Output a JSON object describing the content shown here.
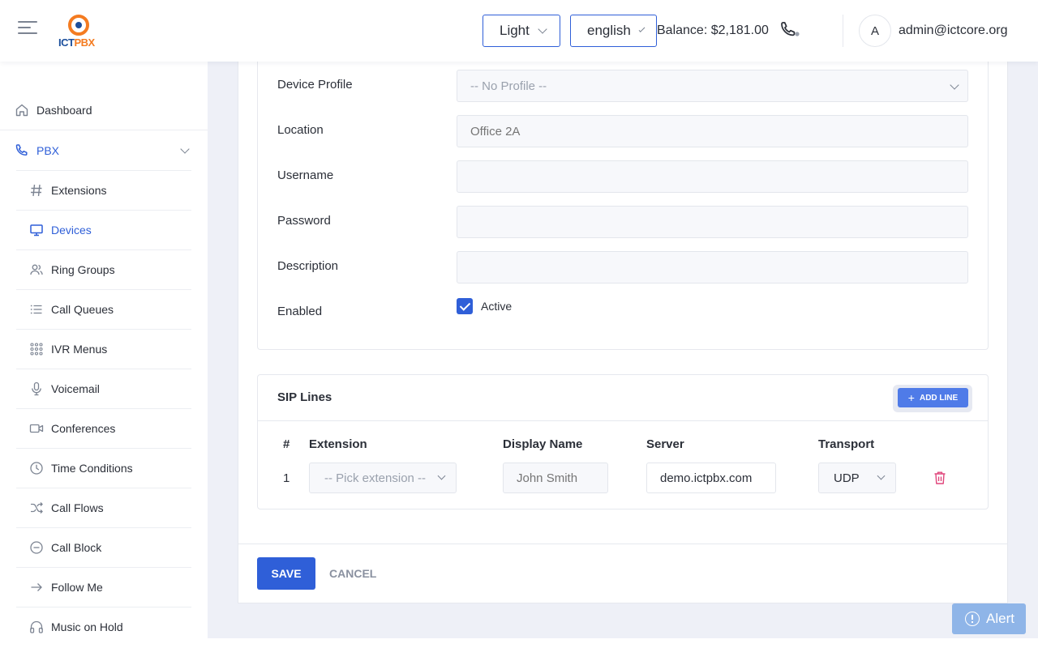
{
  "header": {
    "theme_select": "Light",
    "language_select": "english",
    "balance": "Balance: $2,181.00",
    "avatar_initial": "A",
    "user_email": "admin@ictcore.org",
    "logo_text_ict": "ICT",
    "logo_text_pbx": "PBX"
  },
  "sidebar": {
    "dashboard": "Dashboard",
    "pbx": "PBX",
    "items": [
      {
        "label": "Extensions",
        "icon": "hash-icon"
      },
      {
        "label": "Devices",
        "icon": "monitor-icon",
        "active": true
      },
      {
        "label": "Ring Groups",
        "icon": "users-icon"
      },
      {
        "label": "Call Queues",
        "icon": "list-icon"
      },
      {
        "label": "IVR Menus",
        "icon": "grid-icon"
      },
      {
        "label": "Voicemail",
        "icon": "mic-icon"
      },
      {
        "label": "Conferences",
        "icon": "video-icon"
      },
      {
        "label": "Time Conditions",
        "icon": "clock-icon"
      },
      {
        "label": "Call Flows",
        "icon": "shuffle-icon"
      },
      {
        "label": "Call Block",
        "icon": "minus-circle-icon"
      },
      {
        "label": "Follow Me",
        "icon": "arrow-right-icon"
      },
      {
        "label": "Music on Hold",
        "icon": "headphones-icon"
      }
    ]
  },
  "form": {
    "device_profile_label": "Device Profile",
    "device_profile_value": "-- No Profile --",
    "location_label": "Location",
    "location_placeholder": "Office 2A",
    "username_label": "Username",
    "password_label": "Password",
    "description_label": "Description",
    "enabled_label": "Enabled",
    "active_label": "Active"
  },
  "sip_lines": {
    "title": "SIP Lines",
    "add_line": "ADD LINE",
    "columns": [
      "#",
      "Extension",
      "Display Name",
      "Server",
      "Transport"
    ],
    "rows": [
      {
        "num": "1",
        "extension": "-- Pick extension --",
        "display_name_placeholder": "John Smith",
        "server": "demo.ictpbx.com",
        "transport": "UDP"
      }
    ]
  },
  "actions": {
    "save": "SAVE",
    "cancel": "CANCEL",
    "alert": "Alert"
  },
  "colors": {
    "accent": "#2f5fd8",
    "danger": "#e0457b",
    "logo_orange": "#f47b20",
    "logo_blue": "#1c4f9c"
  }
}
